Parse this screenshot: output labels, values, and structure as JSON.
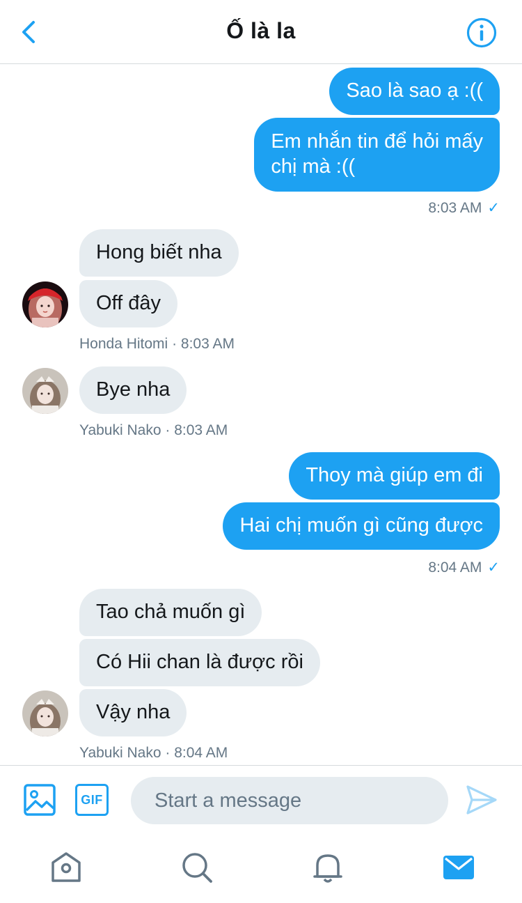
{
  "header": {
    "title": "Ố là la"
  },
  "messages": [
    {
      "text": "Sao là sao ạ :(("
    },
    {
      "text": "Em nhắn tin để hỏi mấy\nchị mà :(("
    },
    {
      "text": "Hong biết nha"
    },
    {
      "text": "Off đây"
    },
    {
      "text": "Bye nha"
    },
    {
      "text": "Thoy mà giúp em đi"
    },
    {
      "text": "Hai chị muốn gì cũng được"
    },
    {
      "text": "Tao chả muốn gì"
    },
    {
      "text": "Có Hii chan là được rồi"
    },
    {
      "text": "Vậy nha"
    }
  ],
  "meta": [
    {
      "time": "8:03 AM"
    },
    {
      "sender": "Honda Hitomi",
      "sep": " · ",
      "time": "8:03 AM"
    },
    {
      "sender": "Yabuki Nako",
      "sep": " · ",
      "time": "8:03 AM"
    },
    {
      "time": "8:04 AM"
    },
    {
      "sender": "Yabuki Nako",
      "sep": " · ",
      "time": "8:04 AM"
    }
  ],
  "read_mark": "✓",
  "composer": {
    "gif_label": "GIF",
    "placeholder": "Start a message"
  },
  "icons": {
    "back": "chevron-left-icon",
    "info": "info-icon",
    "image": "image-icon",
    "gif": "gif-icon",
    "send": "send-icon",
    "home": "home-icon",
    "search": "search-icon",
    "notifications": "bell-icon",
    "messages": "mail-icon"
  },
  "colors": {
    "accent": "#1da1f2",
    "incoming": "#e6ecf0",
    "meta": "#657786",
    "text": "#14171a"
  }
}
